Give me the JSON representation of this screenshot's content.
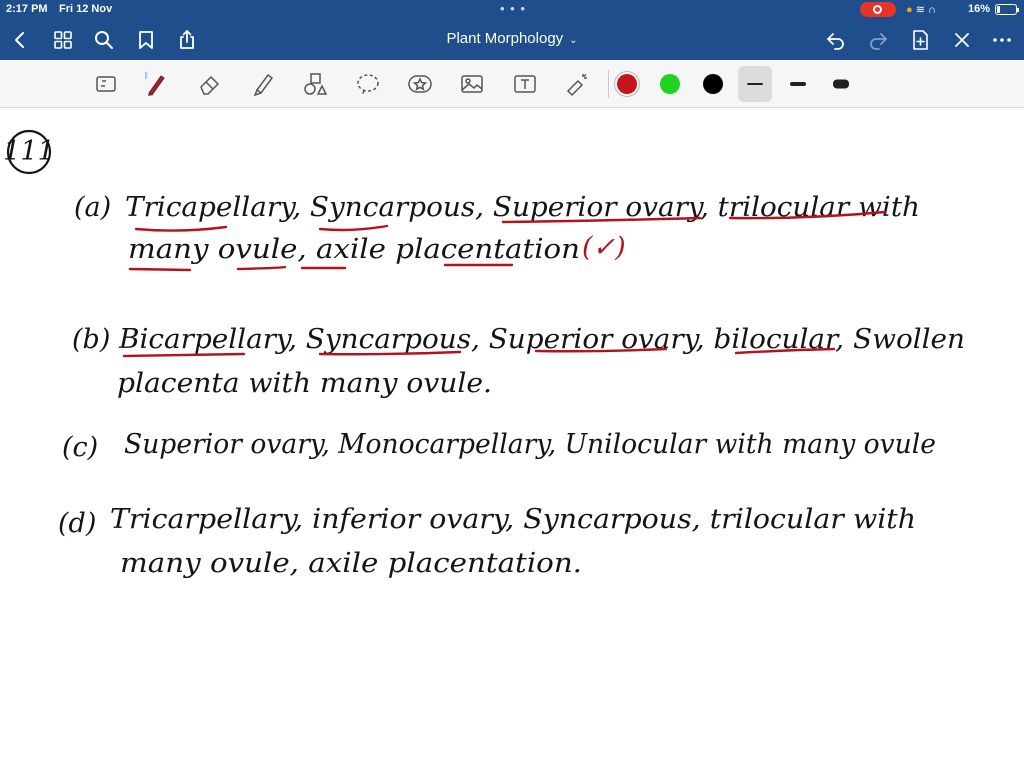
{
  "status_bar": {
    "time": "2:17 PM",
    "date": "Fri 12 Nov",
    "battery": "16%"
  },
  "header": {
    "title": "Plant Morphology",
    "icons": [
      "back-icon",
      "grid-icon",
      "search-icon",
      "bookmark-icon",
      "share-icon",
      "undo-icon",
      "redo-icon",
      "add-page-icon",
      "close-icon",
      "more-icon"
    ]
  },
  "toolbar": {
    "tools": [
      "presentation-icon",
      "pen-icon",
      "eraser-icon",
      "highlighter-icon",
      "shapes-icon",
      "lasso-icon",
      "sticker-icon",
      "image-icon",
      "text-icon",
      "laser-icon"
    ],
    "colors": [
      "#c4151c",
      "#1fd31f",
      "#000000"
    ],
    "selected_color": "#c4151c"
  },
  "notes": {
    "question_number": "111",
    "a_label": "(a)",
    "a_line1": "Tricapellary, Syncarpous, Superior ovary, trilocular with",
    "a_line2": "many ovule, axile placentation",
    "a_mark": "(✓)",
    "b_label": "(b)",
    "b_line1": "Bicarpellary, Syncarpous, Superior ovary, bilocular, Swollen",
    "b_line2": "placenta with many ovule.",
    "c_label": "(c)",
    "c_line1": "Superior ovary, Monocarpellary, Unilocular with many ovule",
    "d_label": "(d)",
    "d_line1": "Tricarpellary, inferior ovary, Syncarpous, trilocular with",
    "d_line2": "many ovule, axile placentation."
  }
}
